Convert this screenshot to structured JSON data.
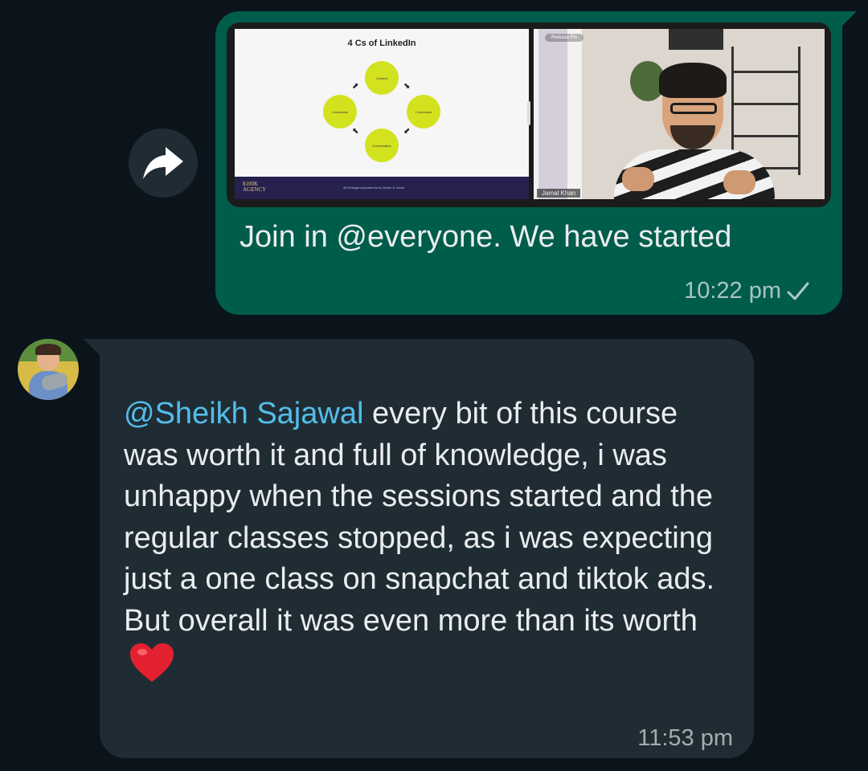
{
  "forward": {
    "icon": "forward-arrow-icon"
  },
  "outgoing": {
    "media": {
      "slide": {
        "title": "4 Cs of LinkedIn",
        "nodes": [
          "Content",
          "Connection",
          "Conversation",
          "Conversion"
        ],
        "brand_line1": "$100K",
        "brand_line2": "AGENCY",
        "credit": "@100kagencyacademia by Ahsan & Jamal"
      },
      "video": {
        "pill": "Release Pin",
        "participant_name": "Jamal Khan"
      }
    },
    "text": "Join in @everyone. We have started",
    "time": "10:22 pm",
    "status_icon": "single-check-icon"
  },
  "incoming": {
    "avatar_icon": "contact-avatar",
    "mention": "@Sheikh Sajawal",
    "text": " every bit of this course was worth it and full of knowledge, i was unhappy when the sessions started and the regular classes stopped, as i was expecting just a one class on snapchat and tiktok ads. But overall it was even more than its worth",
    "emoji_icon": "red-heart-icon",
    "time": "11:53 pm"
  },
  "colors": {
    "background": "#0b141a",
    "outgoing_bubble": "#005c4b",
    "incoming_bubble": "#202c33",
    "mention": "#53bdeb",
    "text": "#e9edef"
  }
}
